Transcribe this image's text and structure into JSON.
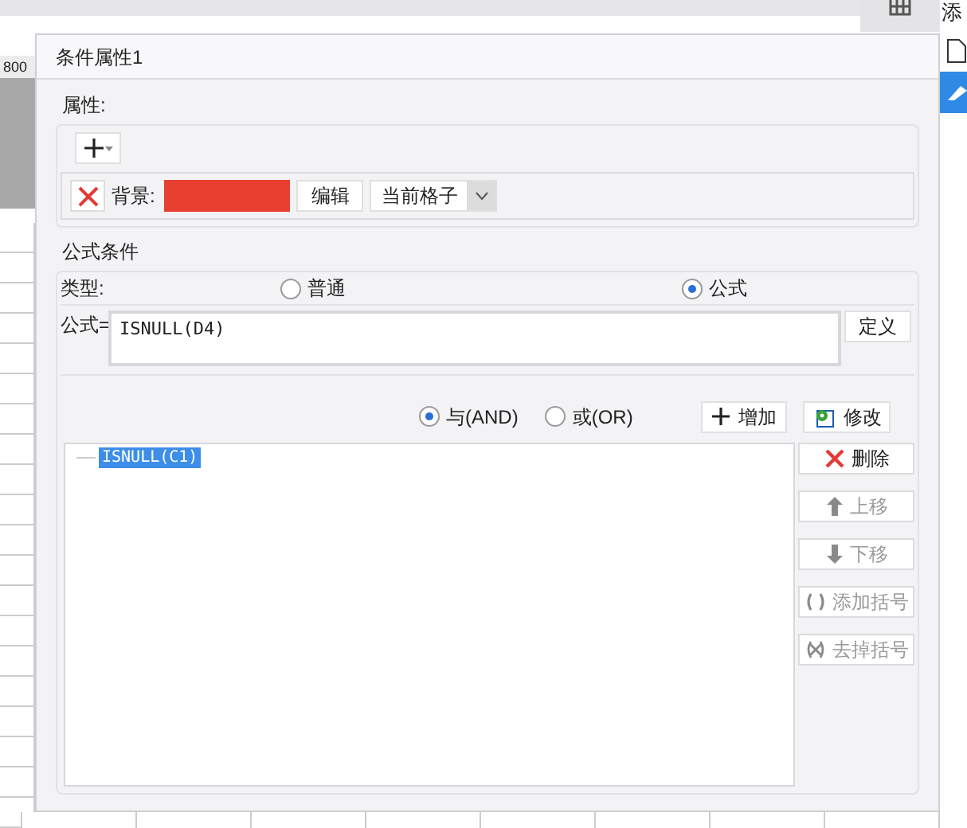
{
  "background": {
    "ruler_label": "800",
    "panel_label": "添"
  },
  "dialog": {
    "title": "条件属性1"
  },
  "attributes": {
    "legend": "属性:",
    "background_label": "背景:",
    "color": "#e84030",
    "edit_button": "编辑",
    "scope": "当前格子"
  },
  "formula_condition": {
    "legend": "公式条件",
    "type_label": "类型:",
    "type_options": [
      {
        "label": "普通",
        "selected": false
      },
      {
        "label": "公式",
        "selected": true
      }
    ],
    "formula_label": "公式=",
    "formula_value": "ISNULL(D4)",
    "define_button": "定义",
    "logic_options": [
      {
        "label": "与(AND)",
        "selected": true
      },
      {
        "label": "或(OR)",
        "selected": false
      }
    ],
    "add_button": "增加",
    "modify_button": "修改",
    "conditions": [
      {
        "text": "ISNULL(C1)",
        "selected": true
      }
    ],
    "side_buttons": [
      {
        "kind": "delete",
        "label": "删除",
        "disabled": false
      },
      {
        "kind": "up",
        "label": "上移",
        "disabled": true
      },
      {
        "kind": "down",
        "label": "下移",
        "disabled": true
      },
      {
        "kind": "add_paren",
        "label": "添加括号",
        "disabled": true
      },
      {
        "kind": "remove_paren",
        "label": "去掉括号",
        "disabled": true
      }
    ]
  }
}
